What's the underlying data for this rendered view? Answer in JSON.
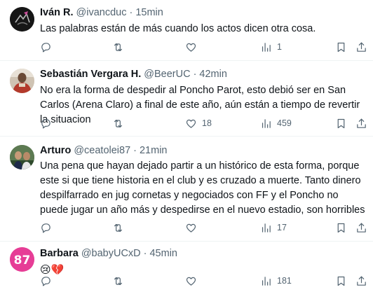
{
  "tweets": [
    {
      "name": "Iván R.",
      "handle": "@ivancduc",
      "sep": "·",
      "time": "15min",
      "text": "Las palabras están de más cuando los actos dicen otra cosa.",
      "likes": "",
      "views": "1"
    },
    {
      "name": "Sebastián Vergara H.",
      "handle": "@BeerUC",
      "sep": "·",
      "time": "42min",
      "text": "No era la forma de despedir al Poncho Parot, esto debió ser en San Carlos (Arena Claro) a final de este año, aún están a tiempo de revertir la situacion",
      "likes": "18",
      "views": "459"
    },
    {
      "name": "Arturo",
      "handle": "@ceatolei87",
      "sep": "·",
      "time": "21min",
      "text": "Una pena que hayan dejado partir a un histórico de esta forma, porque este si que tiene historia en el club y es cruzado a muerte. Tanto dinero despilfarrado en jug cornetas y negociados con FF y el Poncho no puede jugar un año más y despedirse en el nuevo estadio, son horribles",
      "likes": "",
      "views": "17"
    },
    {
      "name": "Barbara",
      "handle": "@babyUCxD",
      "sep": "·",
      "time": "45min",
      "text": "😢💔",
      "likes": "",
      "views": "181"
    }
  ],
  "avatars": {
    "barbara_text": "87"
  },
  "icons": {
    "reply": "reply-icon",
    "retweet": "retweet-icon",
    "like": "heart-icon",
    "views": "views-icon",
    "bookmark": "bookmark-icon",
    "share": "share-icon"
  }
}
